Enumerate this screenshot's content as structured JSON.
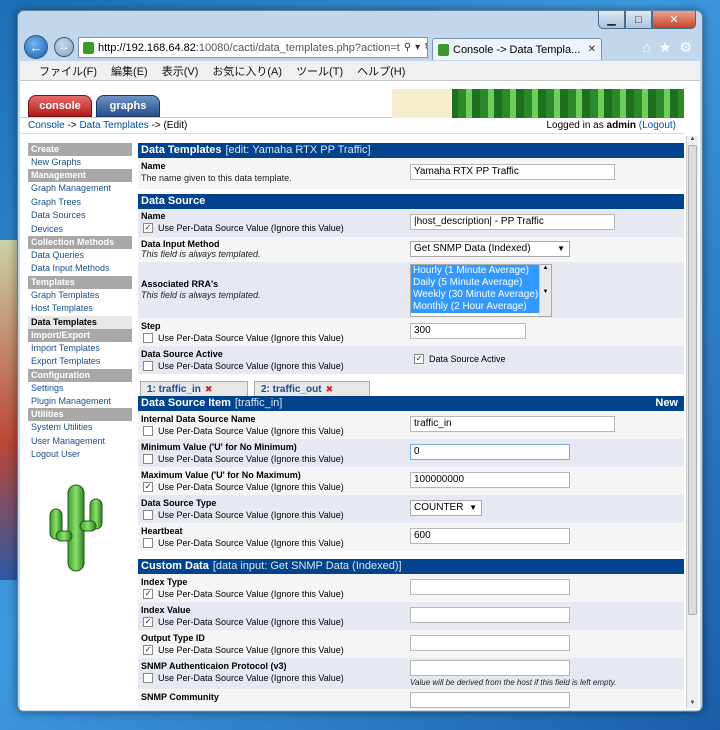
{
  "browser": {
    "address_host": "http://192.168.64.82",
    "address_rest": ":10080/cacti/data_templates.php?action=t",
    "tab_title": "Console -> Data Templa...",
    "menu": [
      "ファイル(F)",
      "編集(E)",
      "表示(V)",
      "お気に入り(A)",
      "ツール(T)",
      "ヘルプ(H)"
    ]
  },
  "cacti": {
    "tabs": {
      "console": "console",
      "graphs": "graphs"
    },
    "breadcrumb": {
      "console": "Console",
      "sep1": " -> ",
      "data_templates": "Data Templates",
      "sep2": " -> ",
      "edit": "(Edit)"
    },
    "login": {
      "prefix": "Logged in as ",
      "user": "admin",
      "logout": "(Logout)"
    }
  },
  "sidebar": [
    {
      "type": "header",
      "label": "Create"
    },
    {
      "type": "item",
      "label": "New Graphs"
    },
    {
      "type": "header",
      "label": "Management"
    },
    {
      "type": "item",
      "label": "Graph Management"
    },
    {
      "type": "item",
      "label": "Graph Trees"
    },
    {
      "type": "item",
      "label": "Data Sources"
    },
    {
      "type": "item",
      "label": "Devices"
    },
    {
      "type": "header",
      "label": "Collection Methods"
    },
    {
      "type": "item",
      "label": "Data Queries"
    },
    {
      "type": "item",
      "label": "Data Input Methods"
    },
    {
      "type": "header",
      "label": "Templates"
    },
    {
      "type": "item",
      "label": "Graph Templates"
    },
    {
      "type": "item",
      "label": "Host Templates"
    },
    {
      "type": "item",
      "label": "Data Templates",
      "active": true
    },
    {
      "type": "header",
      "label": "Import/Export"
    },
    {
      "type": "item",
      "label": "Import Templates"
    },
    {
      "type": "item",
      "label": "Export Templates"
    },
    {
      "type": "header",
      "label": "Configuration"
    },
    {
      "type": "item",
      "label": "Settings"
    },
    {
      "type": "item",
      "label": "Plugin Management"
    },
    {
      "type": "header",
      "label": "Utilities"
    },
    {
      "type": "item",
      "label": "System Utilities"
    },
    {
      "type": "item",
      "label": "User Management"
    },
    {
      "type": "item",
      "label": "Logout User"
    }
  ],
  "common": {
    "per_ds": "Use Per-Data Source Value (Ignore this Value)",
    "templated": "This field is always templated."
  },
  "templates_section": {
    "title": "Data Templates",
    "subtitle": "[edit: Yamaha RTX PP Traffic]",
    "name_label": "Name",
    "name_desc": "The name given to this data template.",
    "name_value": "Yamaha RTX PP Traffic"
  },
  "ds_section": {
    "title": "Data Source",
    "name_label": "Name",
    "name_value": "|host_description| - PP Traffic",
    "method_label": "Data Input Method",
    "method_value": "Get SNMP Data (Indexed)",
    "rra_label": "Associated RRA's",
    "rra_options": [
      "Hourly (1 Minute Average)",
      "Daily (5 Minute Average)",
      "Weekly (30 Minute Average)",
      "Monthly (2 Hour Average)"
    ],
    "step_label": "Step",
    "step_value": "300",
    "active_label": "Data Source Active",
    "active_value_label": "Data Source Active"
  },
  "ds_tabs": [
    {
      "label": "1: traffic_in"
    },
    {
      "label": "2: traffic_out"
    }
  ],
  "item_section": {
    "title": "Data Source Item",
    "subtitle": "[traffic_in]",
    "new_label": "New",
    "internal_label": "Internal Data Source Name",
    "internal_value": "traffic_in",
    "min_label": "Minimum Value ('U' for No Minimum)",
    "min_value": "0",
    "max_label": "Maximum Value ('U' for No Maximum)",
    "max_value": "100000000",
    "type_label": "Data Source Type",
    "type_value": "COUNTER",
    "heartbeat_label": "Heartbeat",
    "heartbeat_value": "600"
  },
  "custom_section": {
    "title": "Custom Data",
    "subtitle": "[data input: Get SNMP Data (Indexed)]",
    "index_type_label": "Index Type",
    "index_value_label": "Index Value",
    "output_type_label": "Output Type ID",
    "snmp_auth_label": "SNMP Authenticaion Protocol (v3)",
    "snmp_auth_hint": "Value will be derived from the host if this field is left empty.",
    "snmp_comm_label": "SNMP Community"
  }
}
